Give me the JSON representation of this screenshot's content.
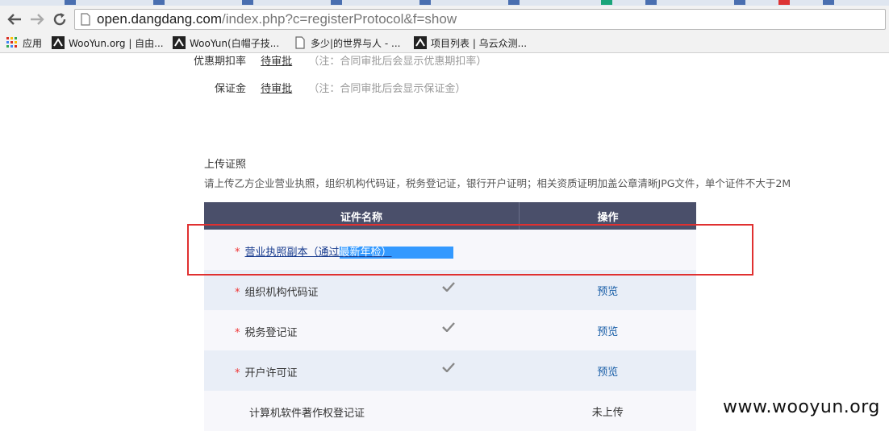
{
  "browser": {
    "url_host": "open.dangdang.com",
    "url_rest": "/index.php?c=registerProtocol&f=show",
    "bookmarks": [
      {
        "label": "应用",
        "icon": "apps-grid-icon"
      },
      {
        "label": "WooYun.org | 自由...",
        "icon": "wooyun-logo-icon"
      },
      {
        "label": "WooYun(白帽子技...",
        "icon": "wooyun-logo-icon"
      },
      {
        "label": "多少|的世界与人 - ...",
        "icon": "page-icon"
      },
      {
        "label": "项目列表 | 乌云众测...",
        "icon": "wooyun-logo-icon"
      }
    ]
  },
  "terms": {
    "discount_label": "优惠期扣率",
    "discount_value": "待审批",
    "discount_note": "（注：合同审批后会显示优惠期扣率）",
    "deposit_label": "保证金",
    "deposit_value": "待审批",
    "deposit_note": "（注：合同审批后会显示保证金）"
  },
  "upload": {
    "title": "上传证照",
    "description": "请上传乙方企业营业执照，组织机构代码证，税务登记证，银行开户证明；相关资质证明加盖公章清晰JPG文件，单个证件不大于2M"
  },
  "table": {
    "headers": [
      "证件名称",
      "操作"
    ],
    "rows": [
      {
        "star": "*",
        "name_plain": "营业执照副本（通过",
        "name_hl": "最新年检）",
        "checked": false,
        "action": ""
      },
      {
        "star": "*",
        "name": "组织机构代码证",
        "checked": true,
        "action": "预览"
      },
      {
        "star": "*",
        "name": "税务登记证",
        "checked": true,
        "action": "预览"
      },
      {
        "star": "*",
        "name": "开户许可证",
        "checked": true,
        "action": "预览"
      },
      {
        "star": "",
        "name": "计算机软件著作权登记证",
        "checked": false,
        "action": "未上传"
      }
    ]
  },
  "watermark": "www.wooyun.org",
  "colors": {
    "accent_red": "#e03030",
    "header_bg": "#4a4f6a",
    "selection": "#3399ff"
  }
}
